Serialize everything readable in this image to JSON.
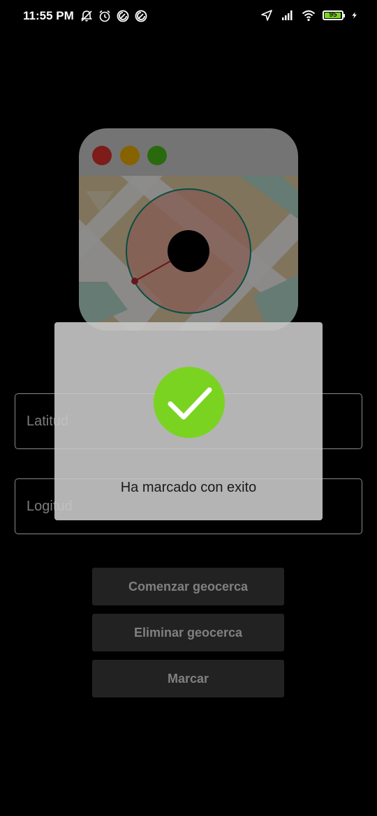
{
  "status_bar": {
    "time": "11:55 PM",
    "battery_level": "95",
    "battery_percent": 95,
    "left_icons": [
      "mute-icon",
      "alarm-icon",
      "data-saver-icon",
      "data-saver-icon"
    ],
    "right_icons": [
      "location-icon",
      "signal-icon",
      "wifi-icon",
      "battery-icon",
      "charging-icon"
    ]
  },
  "form": {
    "latitude_placeholder": "Latitud",
    "longitude_placeholder": "Logitud"
  },
  "buttons": {
    "start_geofence": "Comenzar geocerca",
    "delete_geofence": "Eliminar geocerca",
    "mark": "Marcar"
  },
  "dialog": {
    "message": "Ha marcado con exito",
    "icon": "check-icon"
  },
  "colors": {
    "background": "#000000",
    "success": "#7ad321",
    "dialog": "#c8c8c8",
    "button": "#222222",
    "button_text": "#808080"
  }
}
